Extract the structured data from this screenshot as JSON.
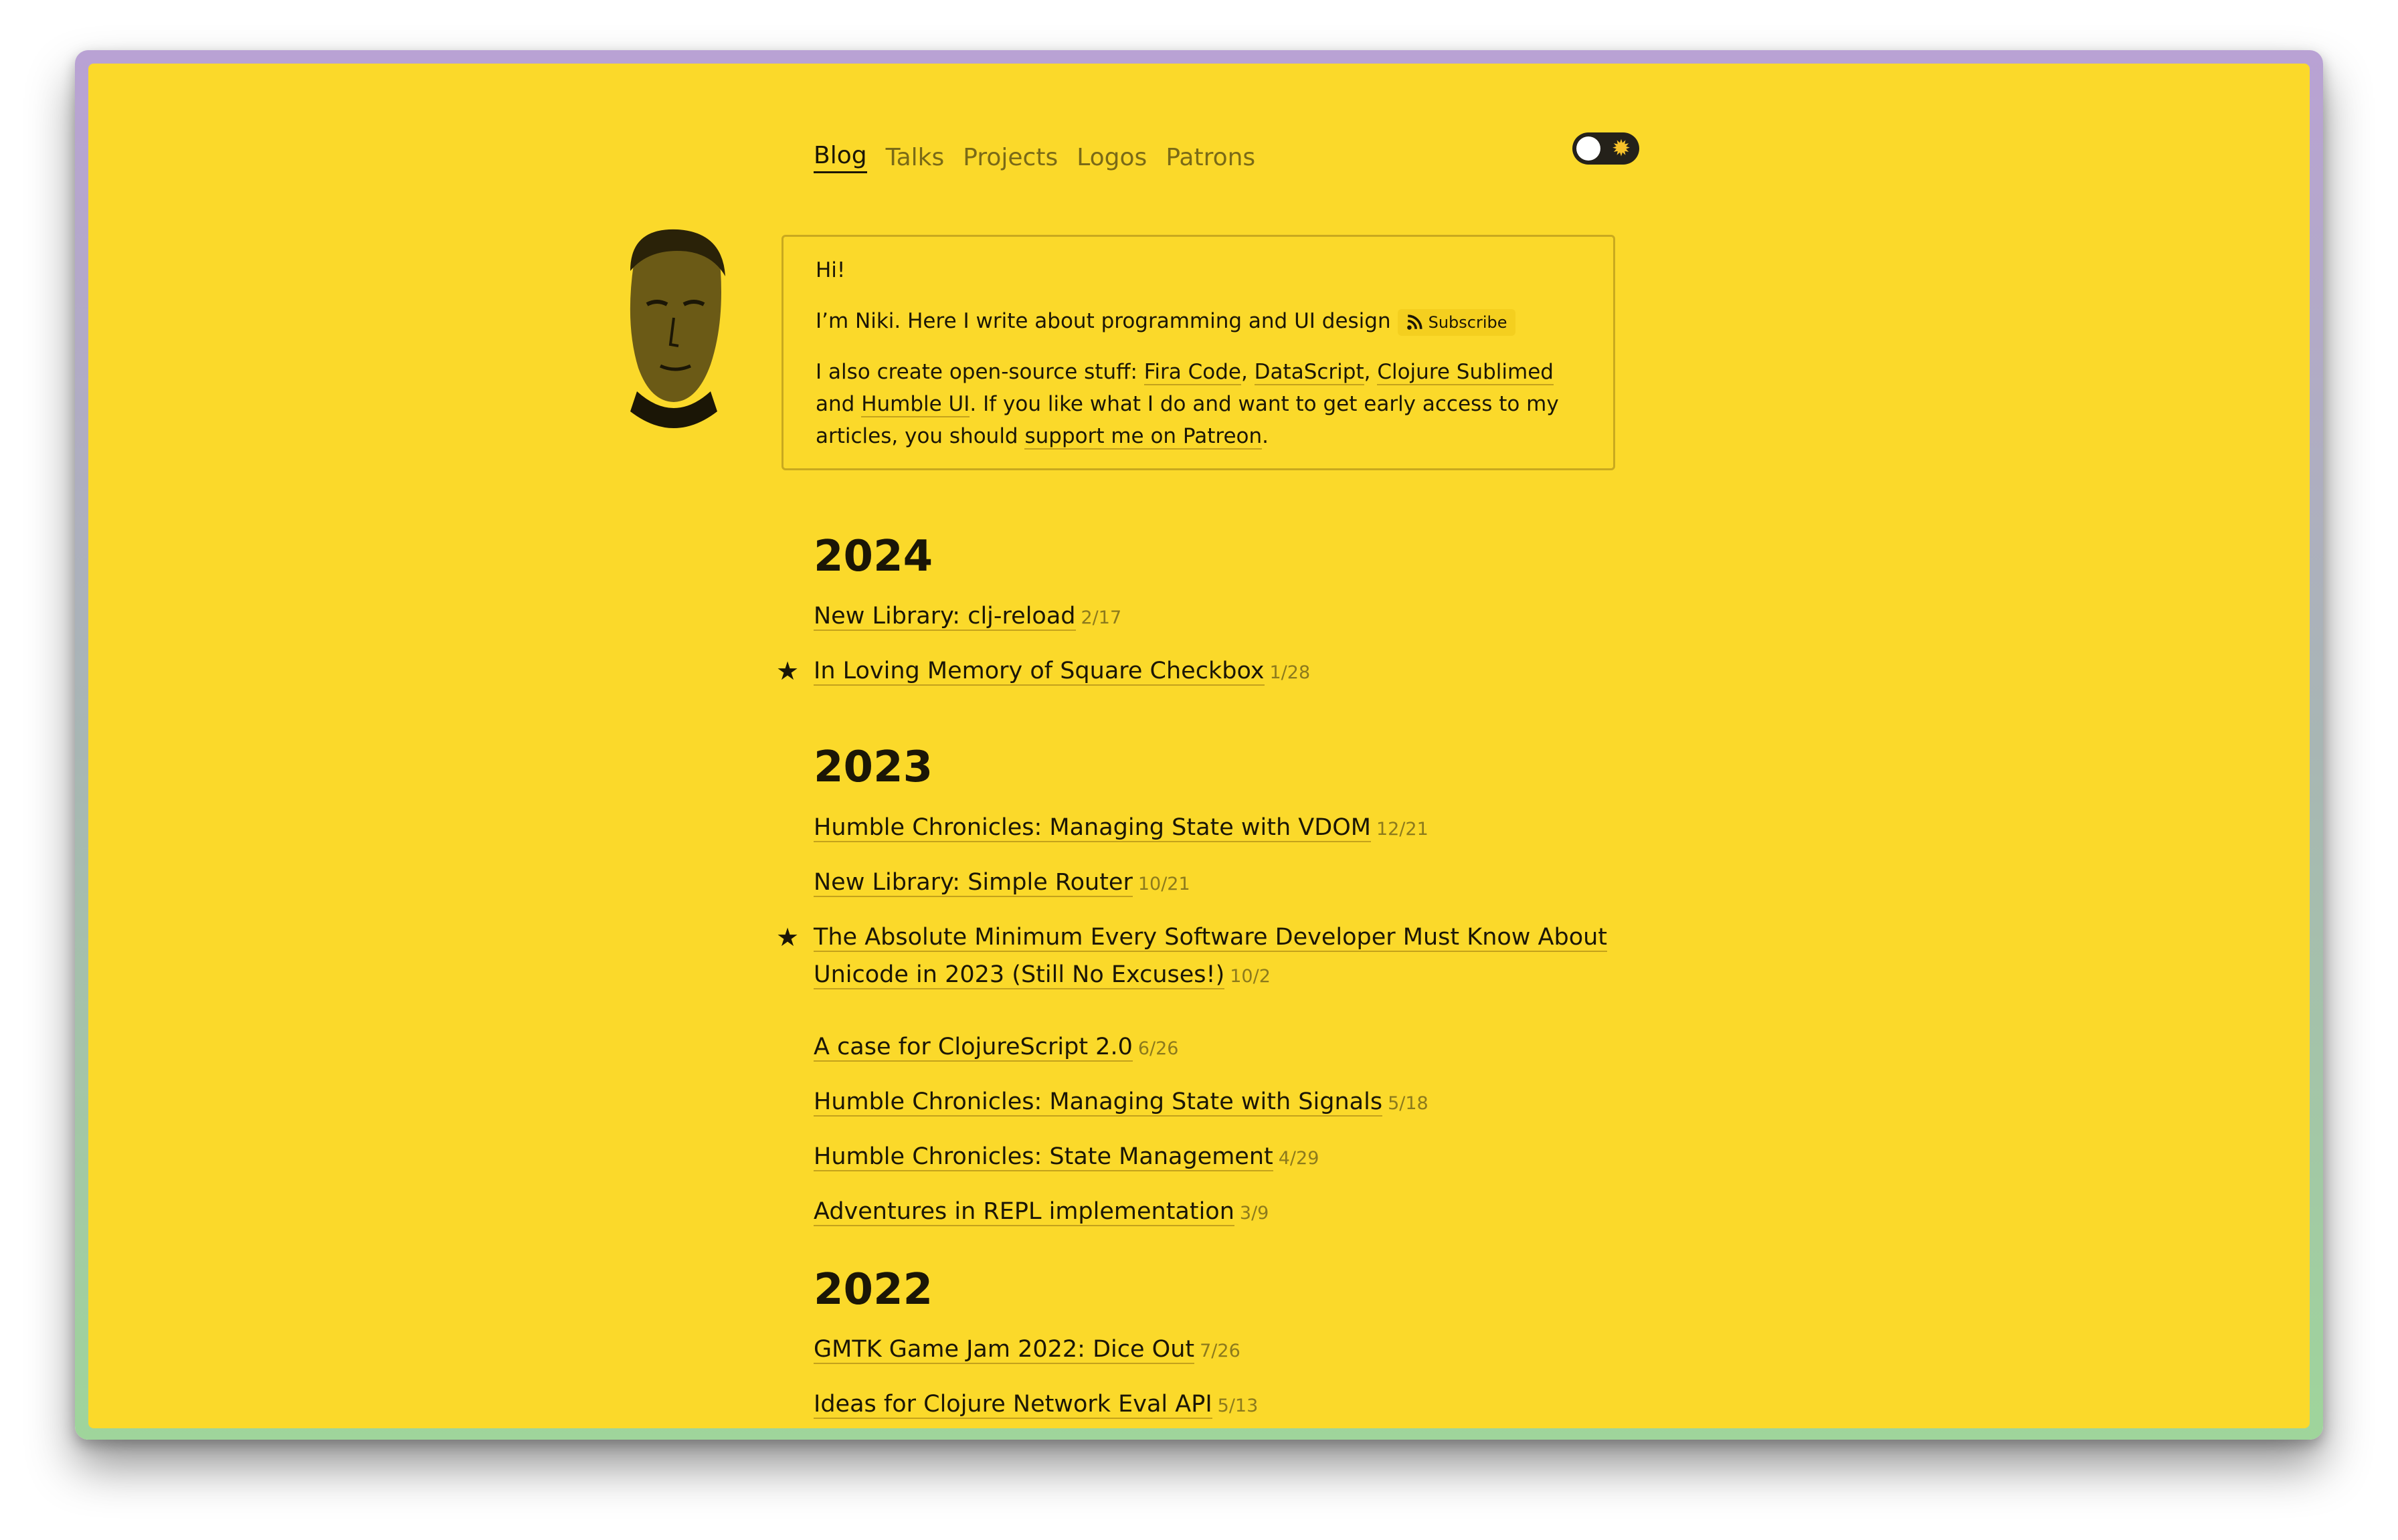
{
  "nav": {
    "items": [
      "Blog",
      "Talks",
      "Projects",
      "Logos",
      "Patrons"
    ],
    "active": "Blog"
  },
  "theme_toggle": {
    "state": "light",
    "icon": "sun-icon"
  },
  "intro": {
    "greeting": "Hi!",
    "line1": "I’m Niki. Here I write about programming and UI design",
    "subscribe_label": "Subscribe",
    "line2_prefix": "I also create open-source stuff: ",
    "link_fira": "Fira Code",
    "sep1": ", ",
    "link_datascript": "DataScript",
    "sep2": ", ",
    "link_clojure_sublimed": "Clojure Sublimed",
    "sep3": " and ",
    "link_humble_ui": "Humble UI",
    "line2_middle": ". If you like what I do and want to get early access to my articles, you should ",
    "link_patreon": "support me on Patreon",
    "line2_end": "."
  },
  "years": [
    {
      "year": "2024",
      "posts": [
        {
          "title": "New Library: clj-reload",
          "date": "2/17",
          "starred": false
        },
        {
          "title": "In Loving Memory of Square Checkbox",
          "date": "1/28",
          "starred": true
        }
      ]
    },
    {
      "year": "2023",
      "posts": [
        {
          "title": "Humble Chronicles: Managing State with VDOM",
          "date": "12/21",
          "starred": false
        },
        {
          "title": "New Library: Simple Router",
          "date": "10/21",
          "starred": false
        },
        {
          "title": "The Absolute Minimum Every Software Developer Must Know About",
          "title_cont": "Unicode in 2023 (Still No Excuses!)",
          "date": "10/2",
          "starred": true
        },
        {
          "title": "A case for ClojureScript 2.0",
          "date": "6/26",
          "starred": false
        },
        {
          "title": "Humble Chronicles: Managing State with Signals",
          "date": "5/18",
          "starred": false
        },
        {
          "title": "Humble Chronicles: State Management",
          "date": "4/29",
          "starred": false
        },
        {
          "title": "Adventures in REPL implementation",
          "date": "3/9",
          "starred": false
        }
      ]
    },
    {
      "year": "2022",
      "posts": [
        {
          "title": "GMTK Game Jam 2022: Dice Out",
          "date": "7/26",
          "starred": false
        },
        {
          "title": "Ideas for Clojure Network Eval API",
          "date": "5/13",
          "starred": false
        }
      ]
    }
  ],
  "colors": {
    "background": "#fbd92a",
    "text": "#1b1606",
    "muted": "#7a6a17",
    "star": "#1b1606"
  }
}
